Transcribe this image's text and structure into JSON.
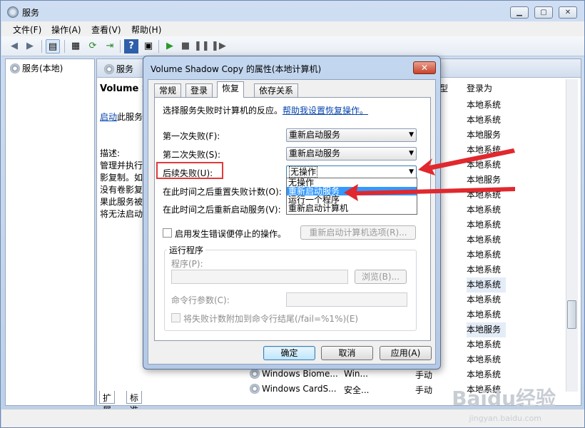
{
  "window": {
    "title": "服务"
  },
  "menu": [
    "文件(F)",
    "操作(A)",
    "查看(V)",
    "帮助(H)"
  ],
  "left_pane": {
    "node": "服务(本地)"
  },
  "right_pane": {
    "header": "服务",
    "service_name": "Volume S",
    "start_link": "启动",
    "start_suffix": "此服务",
    "desc_label": "描述:",
    "desc_lines": [
      "管理并执行",
      "影复制。如",
      "没有卷影复",
      "果此服务被",
      "将无法启动"
    ],
    "col_type": "型",
    "col_logon": "登录为",
    "logon_values": [
      "本地系统",
      "本地系统",
      "本地服务",
      "本地系统",
      "本地系统",
      "本地服务",
      "本地系统",
      "本地系统",
      "本地系统",
      "本地系统",
      "本地系统",
      "本地系统",
      "本地系统",
      "本地系统",
      "本地系统",
      "本地服务",
      "本地系统",
      "本地系统",
      "本地系统",
      "本地系统"
    ],
    "bottom_rows": [
      {
        "name": "Windows Biome...",
        "desc": "Win...",
        "startup": "手动",
        "logon": "本地系统"
      },
      {
        "name": "Windows CardS...",
        "desc": "安全...",
        "startup": "手动",
        "logon": "本地系统"
      }
    ]
  },
  "bottom_tabs": [
    "扩展",
    "标准"
  ],
  "dialog": {
    "title": "Volume Shadow Copy 的属性(本地计算机)",
    "tabs": [
      "常规",
      "登录",
      "恢复",
      "依存关系"
    ],
    "active_tab": "恢复",
    "intro_text": "选择服务失败时计算机的反应。",
    "help_link": "帮助我设置恢复操作。",
    "first_failure_label": "第一次失败(F):",
    "first_failure_value": "重新启动服务",
    "second_failure_label": "第二次失败(S):",
    "second_failure_value": "重新启动服务",
    "subsequent_label": "后续失败(U):",
    "subsequent_value": "无操作",
    "dropdown_options": [
      "无操作",
      "重新启动服务",
      "运行一个程序",
      "重新启动计算机"
    ],
    "dropdown_selected_index": 1,
    "reset_label": "在此时间之后重置失败计数(O):",
    "restart_label": "在此时间之后重新启动服务(V):",
    "enable_stop_label": "启用发生错误便停止的操作。",
    "restart_computer_btn": "重新启动计算机选项(R)...",
    "run_program_group": "运行程序",
    "program_label": "程序(P):",
    "browse_btn": "浏览(B)...",
    "cmd_params_label": "命令行参数(C):",
    "append_fail_label": "将失败计数附加到命令行结尾(/fail=%1%)(E)",
    "ok": "确定",
    "cancel": "取消",
    "apply": "应用(A)"
  },
  "watermark": {
    "brand": "Baidu经验",
    "url": "jingyan.baidu.com"
  },
  "colors": {
    "accent": "#3399ff",
    "highlight_border": "#e03a3a",
    "arrow": "#e0282e"
  }
}
